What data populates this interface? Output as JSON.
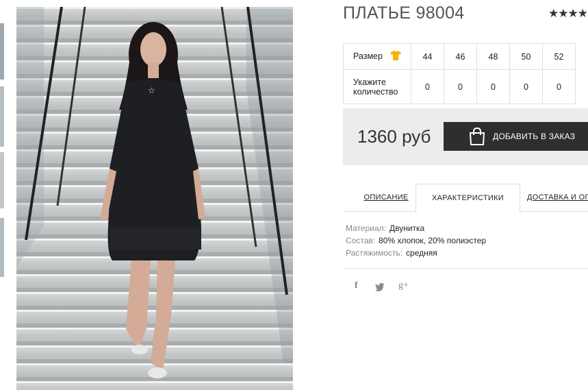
{
  "product": {
    "title": "ПЛАТЬЕ 98004",
    "rating_stars": "★★★★"
  },
  "size_table": {
    "size_label": "Размер",
    "qty_label_line1": "Укажите",
    "qty_label_line2": "количество",
    "sizes": [
      "44",
      "46",
      "48",
      "50",
      "52"
    ],
    "quantities": [
      "0",
      "0",
      "0",
      "0",
      "0"
    ]
  },
  "purchase": {
    "price": "1360 руб",
    "add_button": "ДОБАВИТЬ В ЗАКАЗ"
  },
  "tabs": [
    {
      "label": "ОПИСАНИЕ",
      "active": false
    },
    {
      "label": "ХАРАКТЕРИСТИКИ",
      "active": true
    },
    {
      "label": "ДОСТАВКА И ОПЛАТА",
      "active": false
    }
  ],
  "characteristics": [
    {
      "key": "Материал:",
      "value": "Двунитка"
    },
    {
      "key": "Состав:",
      "value": "80% хлопок, 20% полиэстер"
    },
    {
      "key": "Растяжимость:",
      "value": "средняя"
    }
  ],
  "social": {
    "facebook": "f",
    "twitter": "twitter-icon",
    "google_plus": "g+"
  },
  "colors": {
    "button_bg": "#2e2e2e",
    "price_box_bg": "#ececec",
    "size_icon": "#f5b400"
  }
}
